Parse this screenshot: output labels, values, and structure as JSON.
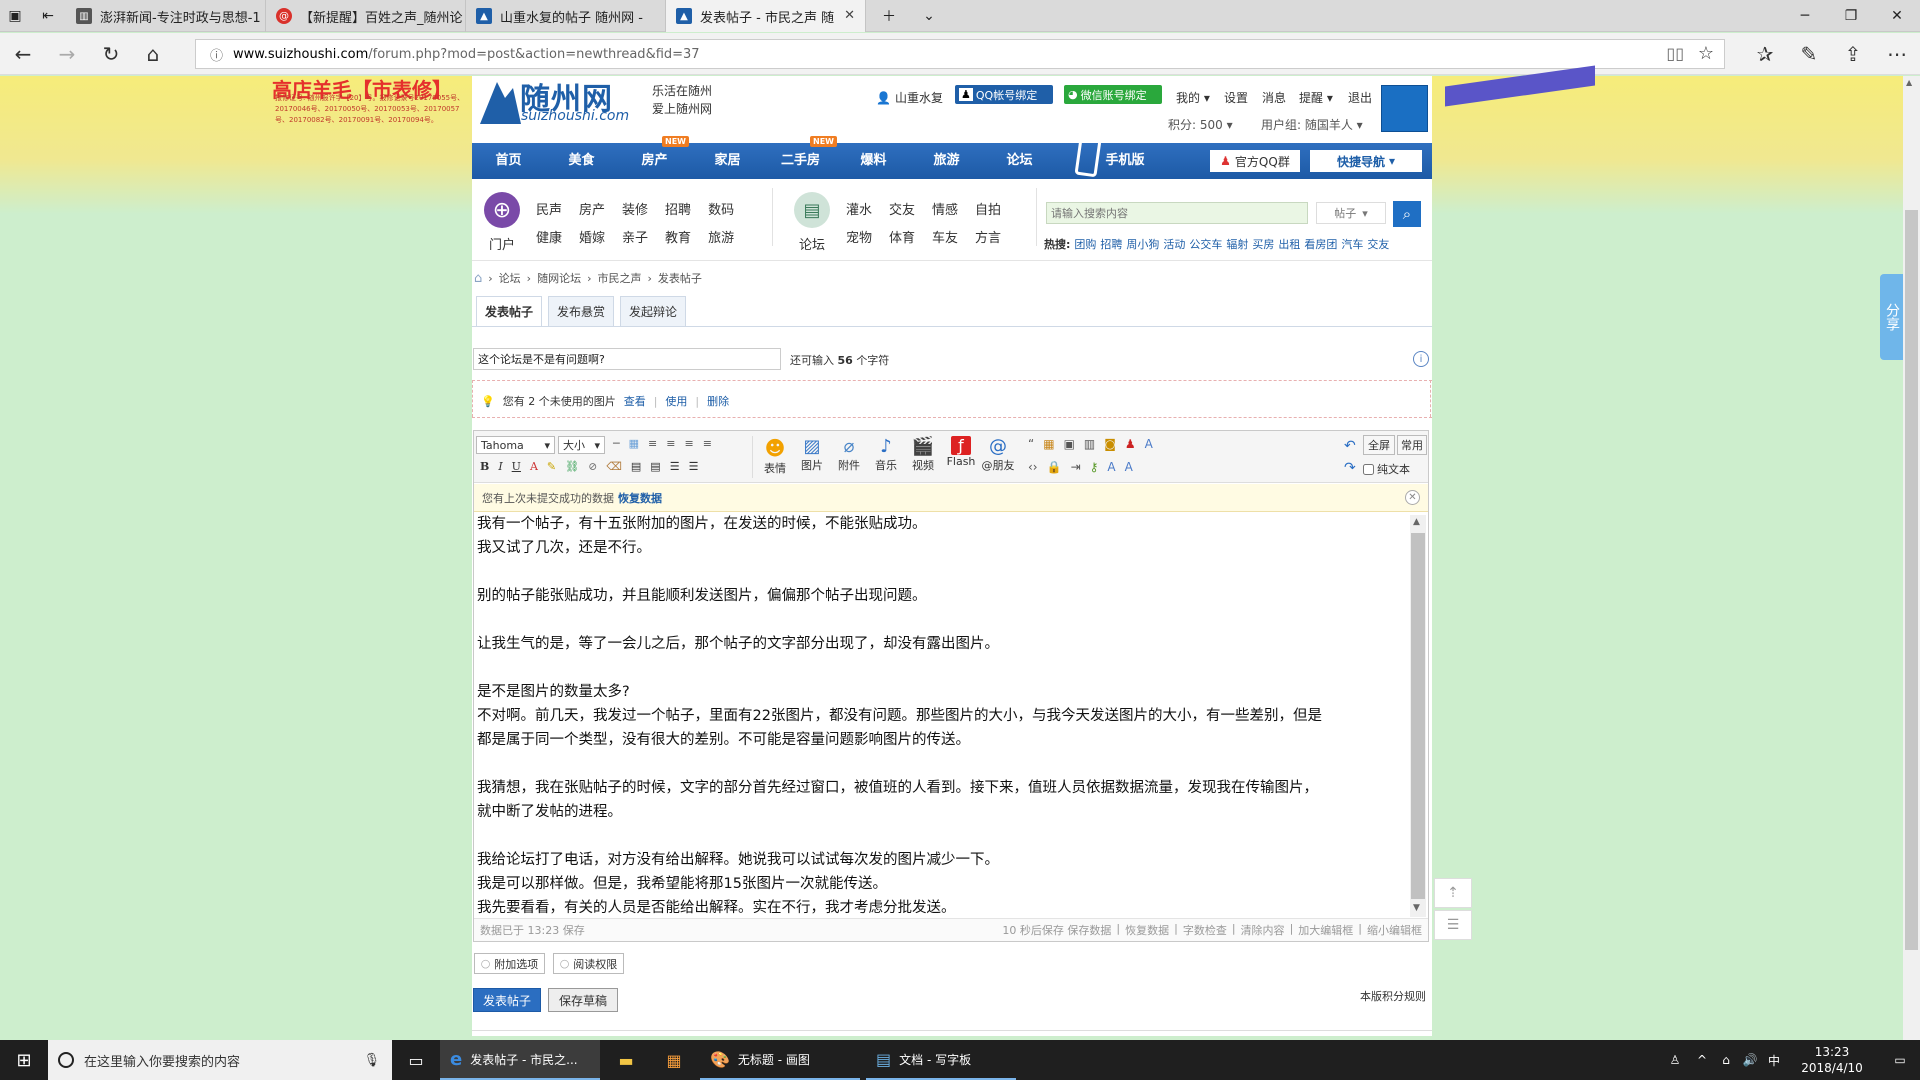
{
  "browser": {
    "tabs": [
      {
        "title": "澎湃新闻-专注时政与思想-1",
        "active": false
      },
      {
        "title": "【新提醒】百姓之声_随州论",
        "active": false
      },
      {
        "title": "山重水复的帖子 随州网 -",
        "active": false
      },
      {
        "title": "发表帖子 - 市民之声 随",
        "active": true
      }
    ],
    "url_host": "www.suizhoushi.com",
    "url_path": "/forum.php?mod=post&action=newthread&fid=37"
  },
  "banner": {
    "left_title": "高店羊毛【市表修】",
    "left_small": "报修证号: 随州报许字【20】号。报修记录号20170055号、20170046号、20170050号、20170053号、20170057号、20170082号、20170091号、20170094号。"
  },
  "site": {
    "logo_text": "随州网",
    "logo_domain": "suizhoushi.com",
    "slogan1": "乐活在随州",
    "slogan2": "爱上随州网",
    "user": "山重水复",
    "qq_bind": "QQ帐号绑定",
    "wechat_bind": "微信账号绑定",
    "top_links": [
      "我的",
      "设置",
      "消息",
      "提醒",
      "退出"
    ],
    "points": "积分: 500",
    "usergroup": "用户组: 随国羊人",
    "nav": [
      "首页",
      "美食",
      "房产",
      "家居",
      "二手房",
      "爆料",
      "旅游",
      "论坛",
      "手机版"
    ],
    "new_label": "NEW",
    "official_qq": "官方QQ群",
    "quick_nav": "快捷导航",
    "portal_label": "门户",
    "forum_label": "论坛",
    "portal_links_row1": [
      "民声",
      "房产",
      "装修",
      "招聘",
      "数码"
    ],
    "portal_links_row2": [
      "健康",
      "婚嫁",
      "亲子",
      "教育",
      "旅游"
    ],
    "forum_links_row1": [
      "灌水",
      "交友",
      "情感",
      "自拍"
    ],
    "forum_links_row2": [
      "宠物",
      "体育",
      "车友",
      "方言"
    ],
    "search_placeholder": "请输入搜索内容",
    "search_type": "帖子",
    "hot_label": "热搜:",
    "hot_links": [
      "团购",
      "招聘",
      "周小狗",
      "活动",
      "公交车",
      "辐射",
      "买房",
      "出租",
      "看房团",
      "汽车",
      "交友"
    ]
  },
  "breadcrumb": [
    "论坛",
    "随网论坛",
    "市民之声",
    "发表帖子"
  ],
  "post_tabs": [
    "发表帖子",
    "发布悬赏",
    "发起辩论"
  ],
  "subject": {
    "value": "这个论坛是不是有问题啊?",
    "remaining_prefix": "还可输入",
    "remaining_count": "56",
    "remaining_suffix": "个字符"
  },
  "unused_images": {
    "text": "您有 2 个未使用的图片",
    "actions": [
      "查看",
      "使用",
      "删除"
    ]
  },
  "editor": {
    "font": "Tahoma",
    "size": "大小",
    "tools_big": [
      "表情",
      "图片",
      "附件",
      "音乐",
      "视频",
      "Flash",
      "@朋友"
    ],
    "fullscreen": "全屏",
    "common": "常用",
    "plaintext": "纯文本",
    "restore_notice": "您有上次未提交成功的数据",
    "restore_link": "恢复数据",
    "content": [
      "我有一个帖子，有十五张附加的图片，在发送的时候，不能张贴成功。",
      "我又试了几次，还是不行。",
      "",
      "别的帖子能张贴成功，并且能顺利发送图片，偏偏那个帖子出现问题。",
      "",
      "让我生气的是，等了一会儿之后，那个帖子的文字部分出现了，却没有露出图片。",
      "",
      "是不是图片的数量太多?",
      "不对啊。前几天，我发过一个帖子，里面有22张图片，都没有问题。那些图片的大小，与我今天发送图片的大小，有一些差别，但是",
      "都是属于同一个类型，没有很大的差别。不可能是容量问题影响图片的传送。",
      "",
      "我猜想，我在张贴帖子的时候，文字的部分首先经过窗口，被值班的人看到。接下来，值班人员依据数据流量，发现我在传输图片，",
      "就中断了发帖的进程。",
      "",
      "我给论坛打了电话，对方没有给出解释。她说我可以试试每次发的图片减少一下。",
      "我是可以那样做。但是，我希望能将那15张图片一次就能传送。",
      "我先要看看，有关的人员是否能给出解释。实在不行，我才考虑分批发送。"
    ],
    "saved_status": "数据已于 13:23 保存",
    "footer_links": [
      "10 秒后保存 保存数据",
      "恢复数据",
      "字数检查",
      "清除内容",
      "加大编辑框",
      "缩小编辑框"
    ]
  },
  "options": [
    "附加选项",
    "阅读权限"
  ],
  "submit_button": "发表帖子",
  "draft_button": "保存草稿",
  "rules_link": "本版积分规则",
  "share_label": "分享",
  "taskbar": {
    "search_placeholder": "在这里输入你要搜索的内容",
    "apps": [
      "发表帖子 - 市民之...",
      "无标题 - 画图",
      "文档 - 写字板"
    ],
    "ime": "中",
    "time": "13:23",
    "date": "2018/4/10"
  },
  "colors": {
    "brand_blue": "#1f5fa8",
    "nav_blue": "#2f6fbf",
    "submit_blue": "#2b6ec1",
    "page_bg": "#cdeecd"
  }
}
